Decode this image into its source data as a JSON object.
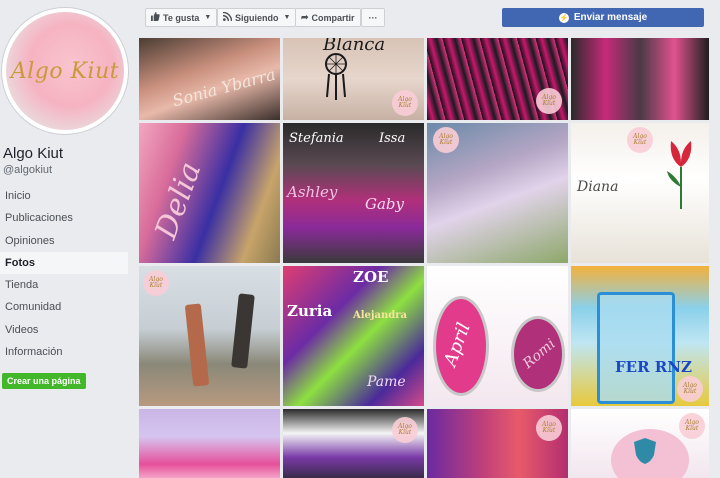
{
  "page": {
    "logo_text": "Algo Kiut",
    "name": "Algo Kiut",
    "handle": "@algokiut"
  },
  "nav": {
    "items": [
      {
        "label": "Inicio"
      },
      {
        "label": "Publicaciones"
      },
      {
        "label": "Opiniones"
      },
      {
        "label": "Fotos"
      },
      {
        "label": "Tienda"
      },
      {
        "label": "Comunidad"
      },
      {
        "label": "Videos"
      },
      {
        "label": "Información"
      }
    ],
    "active_index": 3,
    "create_page_label": "Crear una página"
  },
  "actions": {
    "like_label": "Te gusta",
    "follow_label": "Siguiendo",
    "share_label": "Compartir",
    "more_label": "···",
    "send_message_label": "Enviar mensaje"
  },
  "photos": {
    "tiles": [
      {
        "text": "Sonia Ybarra"
      },
      {
        "text": "Blanca"
      },
      {
        "text": ""
      },
      {
        "text": ""
      },
      {
        "text": "Delia"
      },
      {
        "text": "Stefania"
      },
      {
        "text": "Issa"
      },
      {
        "text": "Ashley"
      },
      {
        "text": "Gaby"
      },
      {
        "text": ""
      },
      {
        "text": "Diana"
      },
      {
        "text": ""
      },
      {
        "text": "ZOE"
      },
      {
        "text": "Zuria"
      },
      {
        "text": "Alejandra"
      },
      {
        "text": "Pame"
      },
      {
        "text": "April"
      },
      {
        "text": "Romi"
      },
      {
        "text": "FER RNZ"
      },
      {
        "text": ""
      },
      {
        "text": ""
      },
      {
        "text": ""
      },
      {
        "text": ""
      }
    ],
    "watermark": "Algo Kiut"
  },
  "colors": {
    "brand_blue": "#4267b2",
    "create_green": "#42b72a",
    "page_bg": "#e9ebee"
  }
}
